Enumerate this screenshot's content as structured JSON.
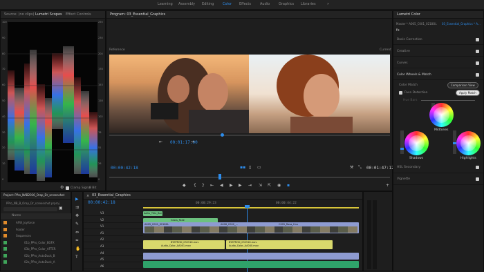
{
  "workspaces": [
    "Learning",
    "Assembly",
    "Editing",
    "Color",
    "Effects",
    "Audio",
    "Graphics",
    "Libraries"
  ],
  "more_chevron": "»",
  "source_panel": {
    "tabs": [
      "Source: (no clips)",
      "Lumetri Scopes",
      "Effect Controls"
    ],
    "scale_left": [
      "100",
      "90",
      "80",
      "70",
      "60",
      "50",
      "40",
      "30",
      "20",
      "10",
      "0"
    ],
    "scale_right": [
      "255",
      "230",
      "204",
      "178",
      "153",
      "128",
      "102",
      "76",
      "51",
      "26",
      "0"
    ],
    "clamp_label": "Clamp Signal",
    "bit_label": "8 Bit"
  },
  "program": {
    "tab": "Program: 03_Essential_Graphics",
    "reference_label": "Reference",
    "current_label": "Current",
    "ref_timecode": "00:01:17:00",
    "timecode_left": "00:00:42:18",
    "timecode_right": "00:01:47:12"
  },
  "lumetri": {
    "tab": "Lumetri Color",
    "master": "Master * A005_C001_0218OL",
    "seq": "03_Essential_Graphics * A...",
    "fx": "fx",
    "sections": [
      "Basic Correction",
      "Creative",
      "Curves",
      "Color Wheels & Match"
    ],
    "color_match": "Color Match",
    "comparison_view": "Comparison View",
    "face_detection": "Face Detection",
    "apply_match": "Apply Match",
    "hue_bars": "Hue Bars",
    "midtones": "Midtones",
    "shadows": "Shadows",
    "highlights": "Highlights",
    "hsl": "HSL Secondary",
    "vignette": "Vignette"
  },
  "project": {
    "tab": "Project: PPro_NAB2016_Orap_Dr_screenshot",
    "file": "PPro_NB_B_Orap_Dr_screenshot.prproj",
    "name_header": "Name",
    "items": [
      {
        "name": "AFW_Joyforce",
        "color": "#e08a2b"
      },
      {
        "name": "Footer",
        "color": "#e08a2b"
      },
      {
        "name": "Sequences",
        "color": "#e08a2b"
      },
      {
        "name": "01b_PPro_Color_BGFX",
        "color": "#3fa55a"
      },
      {
        "name": "03b_PPro_Color_AFTER",
        "color": "#3fa55a"
      },
      {
        "name": "02b_PPro_AutoDuck_B",
        "color": "#3fa55a"
      },
      {
        "name": "02a_PPro_AutoDuck_A",
        "color": "#3fa55a"
      }
    ]
  },
  "timeline": {
    "tab": "03_Essential_Graphics",
    "timecode": "00:00:42:18",
    "ruler": [
      "00:00:29:23",
      "00:00:44:22"
    ],
    "tracks": [
      "V3",
      "V2",
      "V1",
      "A1",
      "A2",
      "A3",
      "A4",
      "A5",
      "A6"
    ],
    "clips_v": [
      "Aaltu_Title_Bar",
      "A005_C001_0218HL",
      "A006_C002_...",
      "Gross_Fade",
      "C005_Rosa_Hnu"
    ],
    "clips_a": [
      "BYEPROD_032516.mov",
      "BYEPROD_032516.mov",
      "Audio_Color_AA001.mov",
      "Audio_Color_AA040.mov"
    ]
  },
  "colors": {
    "accent": "#2d8ceb",
    "video_clip": "#8e9bd1",
    "audio_clip": "#d8d86c",
    "green": "#6cc17f"
  }
}
